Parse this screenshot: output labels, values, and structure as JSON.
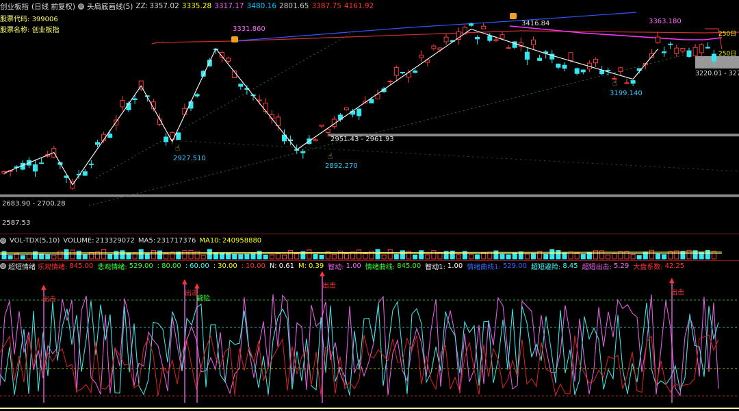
{
  "header": {
    "index_name": "创业板指",
    "period": "(日线 前复权)",
    "indicator": "头肩底画线(5)",
    "zz_label": "ZZ:",
    "zz_value": "3357.02",
    "ma_values": [
      "3335.28",
      "3317.17",
      "3480.16",
      "2801.65",
      "3387.75",
      "4161.92"
    ],
    "ma_colors": [
      "#ffff00",
      "#ff66ff",
      "#00ccff",
      "#cccccc",
      "#ff3333",
      "#ff3333"
    ]
  },
  "info": {
    "code_label": "股票代码:",
    "code_value": "399006",
    "name_label": "股票名称:",
    "name_value": "创业板指"
  },
  "right_labels": {
    "top": "250日",
    "mid": "250日",
    "price_tag": "3220.01 - 327"
  },
  "annotations": {
    "peaks": [
      "3331.860",
      "3416.84",
      "3363.180"
    ],
    "troughs": [
      "2927.510",
      "2892.270",
      "3199.140"
    ],
    "neckline": "2951.43 - 2961.93",
    "low_range": "2683.90 - 2700.28",
    "left_low": "2587.53"
  },
  "volume": {
    "title": "VOL-TDX(5,10)",
    "volume_label": "VOLUME:",
    "volume_value": "213329072",
    "ma5_label": "MA5:",
    "ma5_value": "231717376",
    "ma10_label": "MA10:",
    "ma10_value": "240958880"
  },
  "sentiment": {
    "title": "超短情绪",
    "items": [
      {
        "label": "乐观情绪:",
        "value": "845.00",
        "color": "#ff3333"
      },
      {
        "label": "悲观情绪:",
        "value": "529.00",
        "color": "#33ff33"
      },
      {
        "label": ":",
        "value": "80.00",
        "color": "#33ff33"
      },
      {
        "label": ":",
        "value": "60.00",
        "color": "#33ffff"
      },
      {
        "label": ":",
        "value": "30.00",
        "color": "#ffff00"
      },
      {
        "label": ":",
        "value": "10.00",
        "color": "#ff3333"
      },
      {
        "label": "N:",
        "value": "0.61",
        "color": "#ffffff"
      },
      {
        "label": "M:",
        "value": "0.39",
        "color": "#ffff00"
      },
      {
        "label": "智动:",
        "value": "1.00",
        "color": "#ff66ff"
      },
      {
        "label": "情绪曲线:",
        "value": "845.00",
        "color": "#33ff33"
      },
      {
        "label": "智动1:",
        "value": "1.00",
        "color": "#ffffff"
      },
      {
        "label": "情绪曲线1:",
        "value": "529.00",
        "color": "#3366ff"
      },
      {
        "label": "超短避险:",
        "value": "8.45",
        "color": "#33ffff"
      },
      {
        "label": "超短出击:",
        "value": "5.29",
        "color": "#ff66ff"
      },
      {
        "label": "大盘系数:",
        "value": "42.25",
        "color": "#ff3333"
      }
    ],
    "signal_labels": [
      "出击",
      "出击",
      "避险",
      "出击",
      "出击"
    ]
  },
  "chart_data": [
    {
      "type": "candlestick",
      "title": "创业板指(日线 前复权)",
      "x": [
        1,
        4,
        8,
        12,
        16,
        18,
        20,
        24,
        28,
        30,
        33,
        37,
        41,
        43,
        44,
        46,
        48,
        51,
        55,
        59,
        62,
        65,
        67,
        70,
        74,
        77,
        79,
        83
      ],
      "zigzag_points": [
        {
          "x": 0,
          "y": 2790
        },
        {
          "x": 8,
          "y": 2880
        },
        {
          "x": 11,
          "y": 2740
        },
        {
          "x": 22,
          "y": 3170
        },
        {
          "x": 27,
          "y": 2927.51
        },
        {
          "x": 34,
          "y": 3331.86
        },
        {
          "x": 47,
          "y": 2892.27
        },
        {
          "x": 75,
          "y": 3416.84
        },
        {
          "x": 87,
          "y": 3310
        },
        {
          "x": 101,
          "y": 3199.14
        },
        {
          "x": 105,
          "y": 3330
        }
      ],
      "neckline": [
        2951.43,
        2961.93
      ],
      "support": [
        2683.9,
        2700.28
      ],
      "ylim": [
        2560,
        3460
      ]
    },
    {
      "type": "bar",
      "title": "VOL-TDX(5,10)",
      "series": [
        {
          "name": "VOLUME",
          "last": 213329072
        },
        {
          "name": "MA5",
          "last": 231717376
        },
        {
          "name": "MA10",
          "last": 240958880
        }
      ]
    },
    {
      "type": "line",
      "title": "超短情绪",
      "levels": [
        80,
        60,
        30,
        10
      ],
      "ylim": [
        0,
        100
      ]
    }
  ]
}
